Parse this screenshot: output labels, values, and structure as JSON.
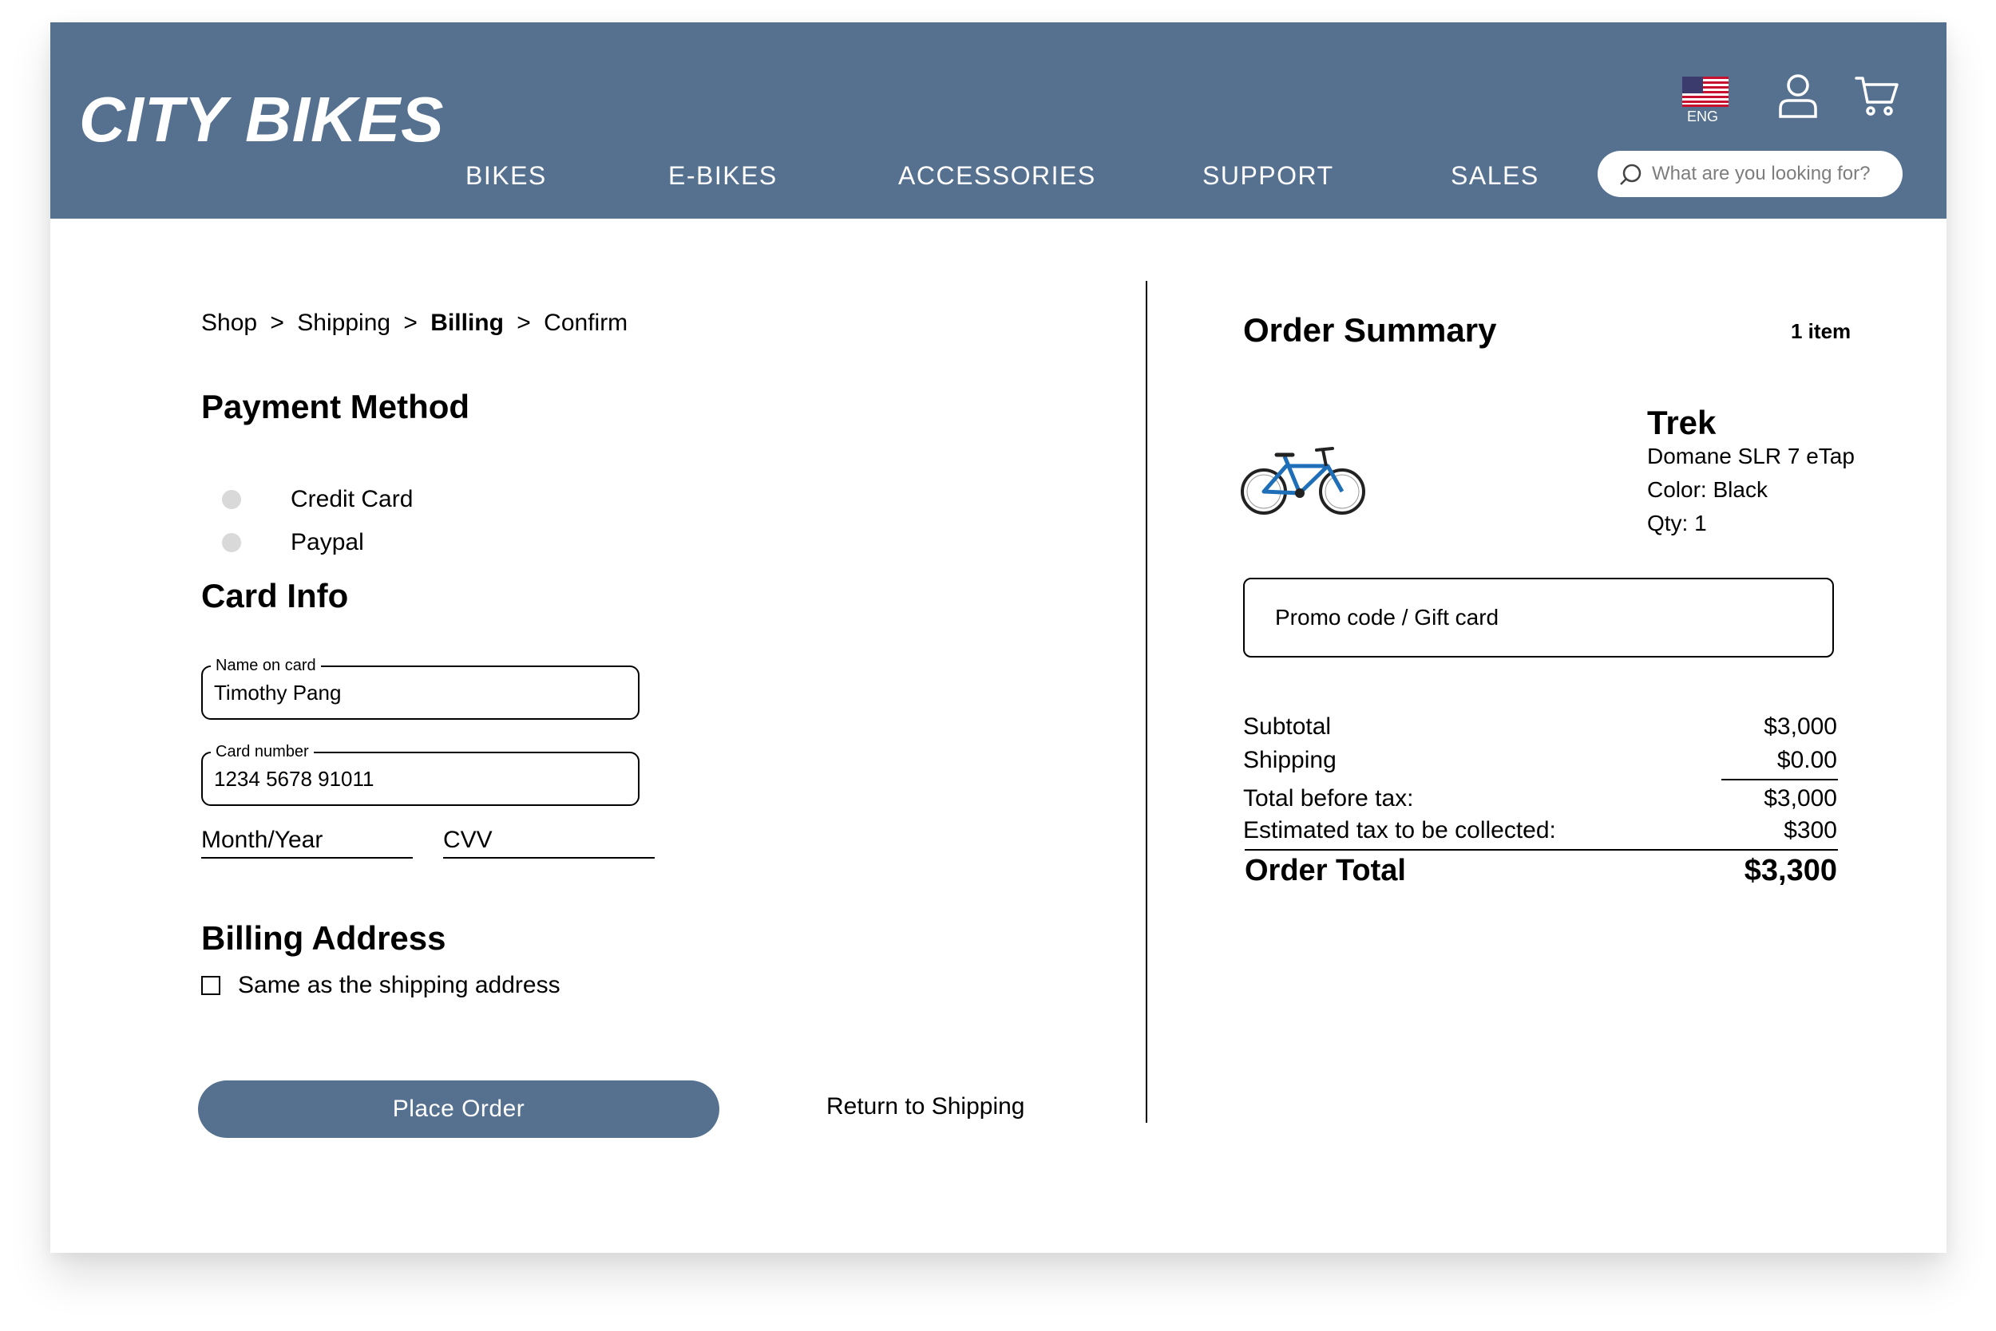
{
  "header": {
    "logo": "CITY BIKES",
    "nav": [
      "BIKES",
      "E-BIKES",
      "ACCESSORIES",
      "SUPPORT",
      "SALES"
    ],
    "search_placeholder": "What are you looking for?",
    "language": "ENG",
    "icons": {
      "flag": "us-flag-icon",
      "user": "user-icon",
      "cart": "cart-icon",
      "search": "search-icon"
    }
  },
  "breadcrumb": {
    "items": [
      "Shop",
      ">",
      "Shipping",
      ">",
      "Billing",
      ">",
      "Confirm"
    ],
    "current": "Billing"
  },
  "payment": {
    "title": "Payment Method",
    "options": [
      "Credit Card",
      "Paypal"
    ]
  },
  "card_info": {
    "title": "Card Info",
    "name_label": "Name on card",
    "name_value": "Timothy Pang",
    "number_label": "Card number",
    "number_value": "1234 5678 91011",
    "month_year_placeholder": "Month/Year",
    "cvv_placeholder": "CVV"
  },
  "billing": {
    "title": "Billing Address",
    "same_as_shipping": "Same as the shipping address"
  },
  "actions": {
    "place_order": "Place Order",
    "return": "Return to Shipping"
  },
  "summary": {
    "title": "Order Summary",
    "item_count": "1 item",
    "product": {
      "brand": "Trek",
      "model": "Domane SLR 7 eTap",
      "color": "Color: Black",
      "qty": "Qty: 1"
    },
    "promo_placeholder": "Promo code / Gift card",
    "subtotal_label": "Subtotal",
    "subtotal": "$3,000",
    "shipping_label": "Shipping",
    "shipping": "$0.00",
    "before_tax_label": "Total before tax:",
    "before_tax": "$3,000",
    "tax_label": "Estimated tax to be collected:",
    "tax": "$300",
    "total_label": "Order Total",
    "total": "$3,300"
  },
  "colors": {
    "brand": "#56718f",
    "radio": "#d9d9d9",
    "bike_frame": "#1f6fb8"
  }
}
